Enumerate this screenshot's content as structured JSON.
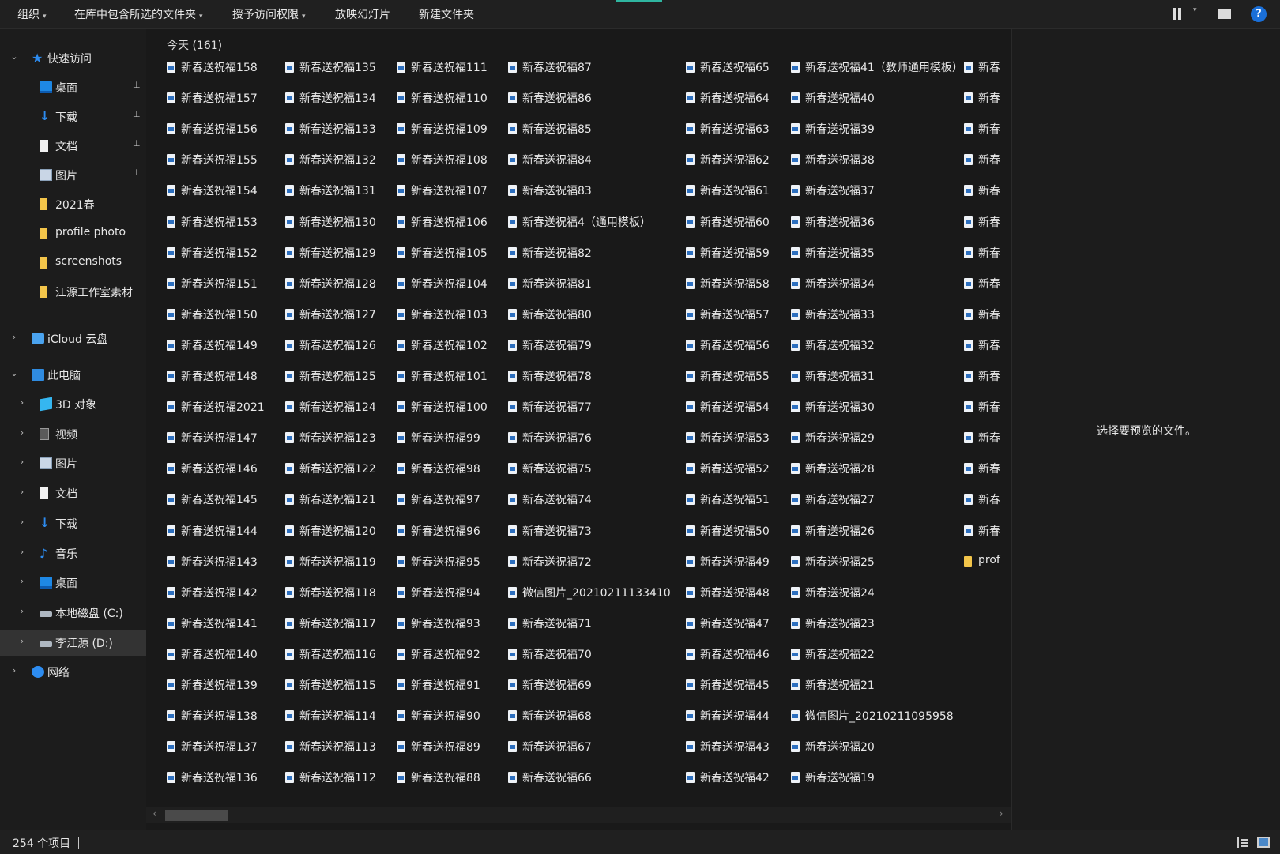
{
  "toolbar": {
    "items": [
      {
        "label": "组织",
        "caret": true
      },
      {
        "label": "在库中包含所选的文件夹",
        "caret": true
      },
      {
        "label": "授予访问权限",
        "caret": true
      },
      {
        "label": "放映幻灯片",
        "caret": false
      },
      {
        "label": "新建文件夹",
        "caret": false
      }
    ],
    "help_label": "?"
  },
  "sidebar": {
    "quick_access": {
      "label": "快速访问",
      "icon": "star-icon"
    },
    "quick_items": [
      {
        "label": "桌面",
        "icon": "desktop-icon",
        "pinned": true
      },
      {
        "label": "下载",
        "icon": "download-icon",
        "pinned": true
      },
      {
        "label": "文档",
        "icon": "document-icon",
        "pinned": true
      },
      {
        "label": "图片",
        "icon": "pictures-icon",
        "pinned": true
      },
      {
        "label": "2021春",
        "icon": "folder-icon",
        "pinned": false
      },
      {
        "label": "profile photo",
        "icon": "folder-icon",
        "pinned": false
      },
      {
        "label": "screenshots",
        "icon": "folder-icon",
        "pinned": false
      },
      {
        "label": "江源工作室素材",
        "icon": "folder-icon",
        "pinned": false
      }
    ],
    "icloud": {
      "label": "iCloud 云盘",
      "icon": "cloud-icon"
    },
    "this_pc": {
      "label": "此电脑",
      "icon": "computer-icon"
    },
    "pc_items": [
      {
        "label": "3D 对象",
        "icon": "3d-objects-icon"
      },
      {
        "label": "视频",
        "icon": "video-icon"
      },
      {
        "label": "图片",
        "icon": "pictures-icon"
      },
      {
        "label": "文档",
        "icon": "document-icon"
      },
      {
        "label": "下载",
        "icon": "download-icon"
      },
      {
        "label": "音乐",
        "icon": "music-icon"
      },
      {
        "label": "桌面",
        "icon": "desktop-icon"
      },
      {
        "label": "本地磁盘 (C:)",
        "icon": "drive-icon"
      },
      {
        "label": "李江源 (D:)",
        "icon": "drive-icon",
        "selected": true
      }
    ],
    "network": {
      "label": "网络",
      "icon": "network-icon"
    }
  },
  "main": {
    "group_header": "今天 (161)",
    "columns": [
      [
        "新春送祝福158",
        "新春送祝福157",
        "新春送祝福156",
        "新春送祝福155",
        "新春送祝福154",
        "新春送祝福153",
        "新春送祝福152",
        "新春送祝福151",
        "新春送祝福150",
        "新春送祝福149",
        "新春送祝福148",
        "新春送祝福2021",
        "新春送祝福147",
        "新春送祝福146",
        "新春送祝福145",
        "新春送祝福144",
        "新春送祝福143",
        "新春送祝福142",
        "新春送祝福141",
        "新春送祝福140",
        "新春送祝福139",
        "新春送祝福138",
        "新春送祝福137",
        "新春送祝福136"
      ],
      [
        "新春送祝福135",
        "新春送祝福134",
        "新春送祝福133",
        "新春送祝福132",
        "新春送祝福131",
        "新春送祝福130",
        "新春送祝福129",
        "新春送祝福128",
        "新春送祝福127",
        "新春送祝福126",
        "新春送祝福125",
        "新春送祝福124",
        "新春送祝福123",
        "新春送祝福122",
        "新春送祝福121",
        "新春送祝福120",
        "新春送祝福119",
        "新春送祝福118",
        "新春送祝福117",
        "新春送祝福116",
        "新春送祝福115",
        "新春送祝福114",
        "新春送祝福113",
        "新春送祝福112"
      ],
      [
        "新春送祝福111",
        "新春送祝福110",
        "新春送祝福109",
        "新春送祝福108",
        "新春送祝福107",
        "新春送祝福106",
        "新春送祝福105",
        "新春送祝福104",
        "新春送祝福103",
        "新春送祝福102",
        "新春送祝福101",
        "新春送祝福100",
        "新春送祝福99",
        "新春送祝福98",
        "新春送祝福97",
        "新春送祝福96",
        "新春送祝福95",
        "新春送祝福94",
        "新春送祝福93",
        "新春送祝福92",
        "新春送祝福91",
        "新春送祝福90",
        "新春送祝福89",
        "新春送祝福88"
      ],
      [
        "新春送祝福87",
        "新春送祝福86",
        "新春送祝福85",
        "新春送祝福84",
        "新春送祝福83",
        "新春送祝福4（通用模板）",
        "新春送祝福82",
        "新春送祝福81",
        "新春送祝福80",
        "新春送祝福79",
        "新春送祝福78",
        "新春送祝福77",
        "新春送祝福76",
        "新春送祝福75",
        "新春送祝福74",
        "新春送祝福73",
        "新春送祝福72",
        "微信图片_20210211133410",
        "新春送祝福71",
        "新春送祝福70",
        "新春送祝福69",
        "新春送祝福68",
        "新春送祝福67",
        "新春送祝福66"
      ],
      [
        "新春送祝福65",
        "新春送祝福64",
        "新春送祝福63",
        "新春送祝福62",
        "新春送祝福61",
        "新春送祝福60",
        "新春送祝福59",
        "新春送祝福58",
        "新春送祝福57",
        "新春送祝福56",
        "新春送祝福55",
        "新春送祝福54",
        "新春送祝福53",
        "新春送祝福52",
        "新春送祝福51",
        "新春送祝福50",
        "新春送祝福49",
        "新春送祝福48",
        "新春送祝福47",
        "新春送祝福46",
        "新春送祝福45",
        "新春送祝福44",
        "新春送祝福43",
        "新春送祝福42"
      ],
      [
        "新春送祝福41（教师通用模板）",
        "新春送祝福40",
        "新春送祝福39",
        "新春送祝福38",
        "新春送祝福37",
        "新春送祝福36",
        "新春送祝福35",
        "新春送祝福34",
        "新春送祝福33",
        "新春送祝福32",
        "新春送祝福31",
        "新春送祝福30",
        "新春送祝福29",
        "新春送祝福28",
        "新春送祝福27",
        "新春送祝福26",
        "新春送祝福25",
        "新春送祝福24",
        "新春送祝福23",
        "新春送祝福22",
        "新春送祝福21",
        "微信图片_20210211095958",
        "新春送祝福20",
        "新春送祝福19"
      ],
      [
        "新春",
        "新春",
        "新春",
        "新春",
        "新春",
        "新春",
        "新春",
        "新春",
        "新春",
        "新春",
        "新春",
        "新春",
        "新春",
        "新春",
        "新春",
        "新春",
        "prof"
      ]
    ]
  },
  "preview": {
    "message": "选择要预览的文件。"
  },
  "status": {
    "item_count": "254 个项目"
  },
  "colors": {
    "background": "#191919",
    "accent": "#2d8cf0",
    "folder": "#f3c54a",
    "selected_row": "#333333"
  }
}
